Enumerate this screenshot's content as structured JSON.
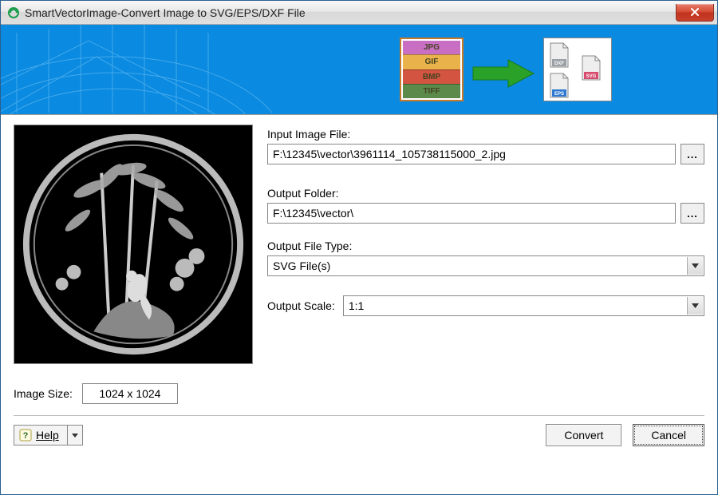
{
  "window": {
    "title": "SmartVectorImage-Convert Image to SVG/EPS/DXF File"
  },
  "banner": {
    "input_formats": [
      "JPG",
      "GIF",
      "BMP",
      "TIFF"
    ],
    "output_formats": [
      "DXF",
      "SVG",
      "EPS"
    ],
    "format_colors": {
      "JPG": "#c96fc3",
      "GIF": "#e9b24a",
      "BMP": "#d35440",
      "TIFF": "#5b8a4a"
    },
    "output_colors": {
      "DXF": "#9aa0a6",
      "SVG": "#d84a6e",
      "EPS": "#2f78d1"
    }
  },
  "form": {
    "input_label": "Input Image File:",
    "input_value": "F:\\12345\\vector\\3961114_105738115000_2.jpg",
    "output_folder_label": "Output Folder:",
    "output_folder_value": "F:\\12345\\vector\\",
    "output_type_label": "Output File Type:",
    "output_type_value": "SVG File(s)",
    "output_scale_label": "Output Scale:",
    "output_scale_value": "1:1",
    "browse_label": "..."
  },
  "image_info": {
    "label": "Image Size:",
    "value": "1024 x 1024"
  },
  "footer": {
    "help_label": "Help",
    "convert_label": "Convert",
    "cancel_label": "Cancel"
  }
}
